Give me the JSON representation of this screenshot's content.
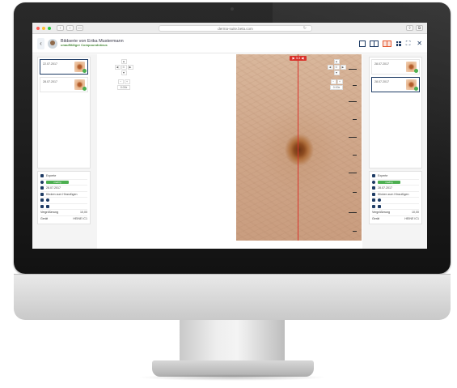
{
  "browser": {
    "url": "derma-suite.beta.com",
    "traffic_lights": [
      "#ff5f57",
      "#febc2e",
      "#28c840"
    ],
    "back_glyph": "‹",
    "forward_glyph": "›",
    "sidebar_glyph": "▭",
    "reload_glyph": "↻",
    "share_glyph": "⇪",
    "tabs_glyph": "⧉"
  },
  "header": {
    "title": "Bildserie von Erika Mustermann",
    "subtitle": "unauffälliger Compoundnävus",
    "back_glyph": "‹",
    "expand_glyph": "⛶",
    "close_glyph": "✕",
    "accent_color": "#e4572e",
    "icon_color": "#1e3b64"
  },
  "left_sidebar": {
    "thumbnails": [
      {
        "date": "22.07.2017",
        "active": true
      },
      {
        "date": "28.07.2017",
        "active": false
      }
    ],
    "info": {
      "expert_label": "Experte",
      "status_label": "niedrig",
      "date": "28.07.2017",
      "note": "Klicken zum Hinzufügen",
      "compare_label": "Vergrößerung",
      "compare_value": "10,00",
      "device_label": "Gerät",
      "device_value": "HEINE IC1"
    }
  },
  "right_sidebar": {
    "thumbnails": [
      {
        "date": "28.07.2017",
        "active": false
      },
      {
        "date": "28.07.2017",
        "active": true
      }
    ],
    "info": {
      "expert_label": "Experte",
      "status_label": "niedrig",
      "date": "28.07.2017",
      "note": "Klicken zum Hinzufügen",
      "compare_label": "Vergrößerung",
      "compare_value": "10,00",
      "device_label": "Gerät",
      "device_value": "HEINE IC1"
    }
  },
  "zoom_left": {
    "up": "▲",
    "down": "▼",
    "left": "◀",
    "right": "▶",
    "center": "⊙",
    "zoom_out": "−",
    "zoom_in": "+",
    "level": "0.00x"
  },
  "zoom_right": {
    "up": "▲",
    "down": "▼",
    "left": "◀",
    "right": "▶",
    "center": "⊙",
    "zoom_out": "−",
    "zoom_in": "+",
    "level": "0.00x"
  },
  "image_viewer": {
    "ruler_label": "▶ 3.3 ◀",
    "ruler_color": "#d9322b"
  }
}
